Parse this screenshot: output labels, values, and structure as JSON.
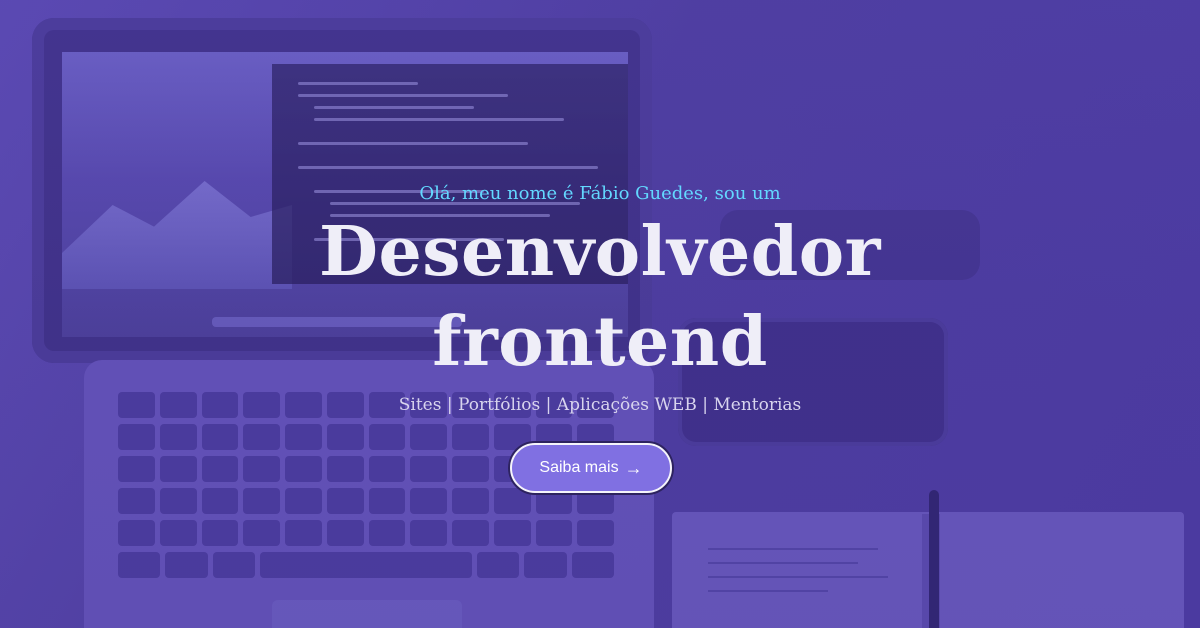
{
  "hero": {
    "intro": "Olá, meu nome é Fábio Guedes, sou um",
    "title_line_1": "Desenvolvedor",
    "title_line_2": "frontend",
    "services": "Sites | Portfólios | Aplicações WEB | Mentorias",
    "cta_label": "Saiba mais",
    "cta_icon": "→"
  },
  "colors": {
    "background": "#4f3e9f",
    "intro_text": "#63d8ff",
    "title_text": "#efeef8",
    "button_fill": "#8070e2",
    "button_border": "#f5f4fb"
  },
  "background_scene": {
    "icon_names": [
      "laptop-icon",
      "phone-icon",
      "notebook-icon",
      "pen-icon",
      "camera-icon"
    ]
  }
}
